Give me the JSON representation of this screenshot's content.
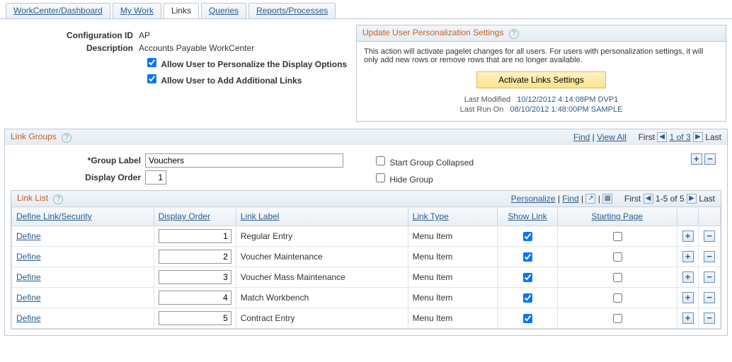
{
  "tabs": {
    "workcenter": "WorkCenter/Dashboard",
    "mywork": "My Work",
    "links": "Links",
    "queries": "Queries",
    "reports": "Reports/Processes"
  },
  "config": {
    "id_label": "Configuration ID",
    "id_value": "AP",
    "desc_label": "Description",
    "desc_value": "Accounts Payable WorkCenter",
    "allow_personalize": "Allow User to Personalize the Display Options",
    "allow_addlinks": "Allow User to Add Additional Links"
  },
  "update_panel": {
    "title": "Update User Personalization Settings",
    "body": "This action will activate pagelet changes for all users.  For users with personalization settings, it will only add new rows or remove rows that are no longer available.",
    "button": "Activate Links Settings",
    "last_modified_label": "Last Modified",
    "last_modified_val": "10/12/2012  4:14:08PM  DVP1",
    "last_run_label": "Last Run On",
    "last_run_val": "08/10/2012  1:48:00PM  SAMPLE"
  },
  "link_groups": {
    "title": "Link Groups",
    "find": "Find",
    "viewall": "View All",
    "first": "First",
    "counter": "1 of 3",
    "last": "Last",
    "group_label_lbl": "*Group Label",
    "group_label_val": "Vouchers",
    "display_order_lbl": "Display Order",
    "display_order_val": "1",
    "start_collapsed": "Start Group Collapsed",
    "hide_group": "Hide Group"
  },
  "link_list": {
    "title": "Link List",
    "personalize": "Personalize",
    "find": "Find",
    "first": "First",
    "counter": "1-5 of 5",
    "last": "Last",
    "cols": {
      "define": "Define Link/Security",
      "order": "Display Order",
      "label": "Link Label",
      "type": "Link Type",
      "show": "Show Link",
      "start": "Starting Page"
    },
    "define_text": "Define",
    "rows": [
      {
        "order": "1",
        "label": "Regular Entry",
        "type": "Menu Item",
        "show": true,
        "start": false
      },
      {
        "order": "2",
        "label": "Voucher Maintenance",
        "type": "Menu Item",
        "show": true,
        "start": false
      },
      {
        "order": "3",
        "label": "Voucher Mass Maintenance",
        "type": "Menu Item",
        "show": true,
        "start": false
      },
      {
        "order": "4",
        "label": "Match Workbench",
        "type": "Menu Item",
        "show": true,
        "start": false
      },
      {
        "order": "5",
        "label": "Contract Entry",
        "type": "Menu Item",
        "show": true,
        "start": false
      }
    ]
  }
}
